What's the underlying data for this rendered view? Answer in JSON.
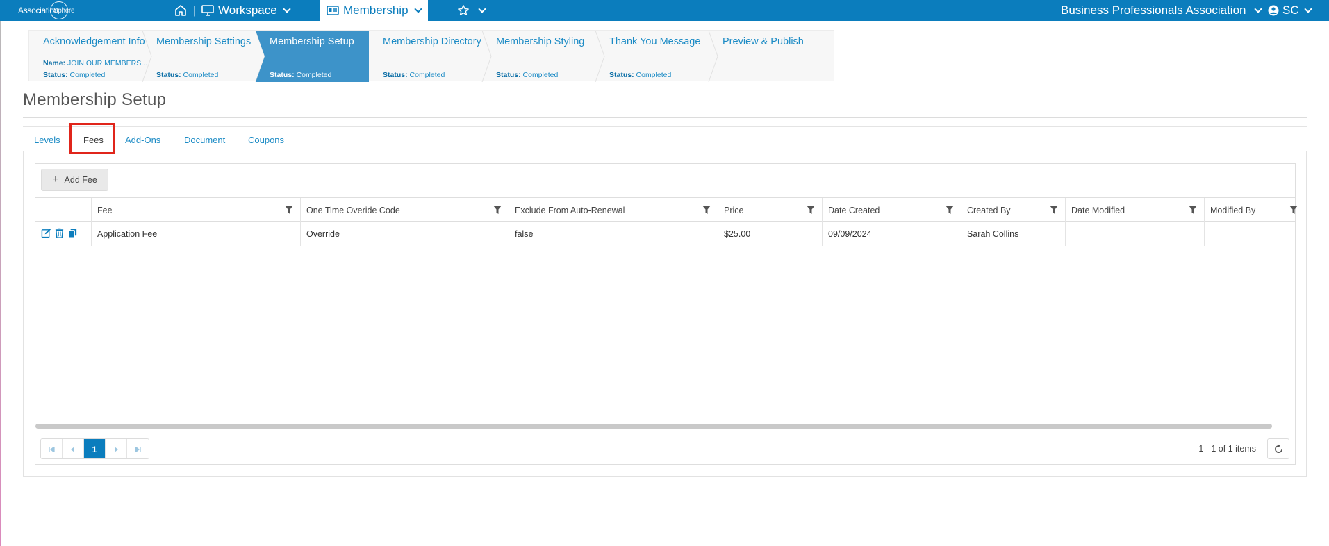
{
  "topbar": {
    "logo_text_a": "Association",
    "logo_text_b": "Sphere",
    "workspace_label": "Workspace",
    "membership_label": "Membership",
    "separator": "|",
    "org_name": "Business Professionals Association",
    "user_initials": "SC",
    "colors": {
      "bar": "#0b7dbd",
      "active_bg": "#ffffff"
    }
  },
  "wizard": {
    "steps": [
      {
        "title": "Acknowledgement Info",
        "name_label": "Name:",
        "name_value": "JOIN OUR MEMBERS...",
        "status_label": "Status:",
        "status_value": "Completed"
      },
      {
        "title": "Membership Settings",
        "status_label": "Status:",
        "status_value": "Completed"
      },
      {
        "title": "Membership Setup",
        "status_label": "Status:",
        "status_value": "Completed",
        "active": true
      },
      {
        "title": "Membership Directory",
        "status_label": "Status:",
        "status_value": "Completed"
      },
      {
        "title": "Membership Styling",
        "status_label": "Status:",
        "status_value": "Completed"
      },
      {
        "title": "Thank You Message",
        "status_label": "Status:",
        "status_value": "Completed"
      },
      {
        "title": "Preview & Publish"
      }
    ],
    "active_color": "#3d93c9"
  },
  "page": {
    "title": "Membership Setup"
  },
  "tabs": [
    {
      "label": "Levels"
    },
    {
      "label": "Fees",
      "selected": true
    },
    {
      "label": "Add-Ons"
    },
    {
      "label": "Document"
    },
    {
      "label": "Coupons"
    }
  ],
  "grid": {
    "add_button_label": "Add Fee",
    "columns": [
      "Fee",
      "One Time Overide Code",
      "Exclude From Auto-Renewal",
      "Price",
      "Date Created",
      "Created By",
      "Date Modified",
      "Modified By"
    ],
    "rows": [
      {
        "fee": "Application Fee",
        "override": "Override",
        "exclude": "false",
        "price": "$25.00",
        "date_created": "09/09/2024",
        "created_by": "Sarah Collins",
        "date_modified": "",
        "modified_by": ""
      }
    ],
    "pager": {
      "current_page": "1",
      "items_info": "1 - 1 of 1 items"
    }
  }
}
